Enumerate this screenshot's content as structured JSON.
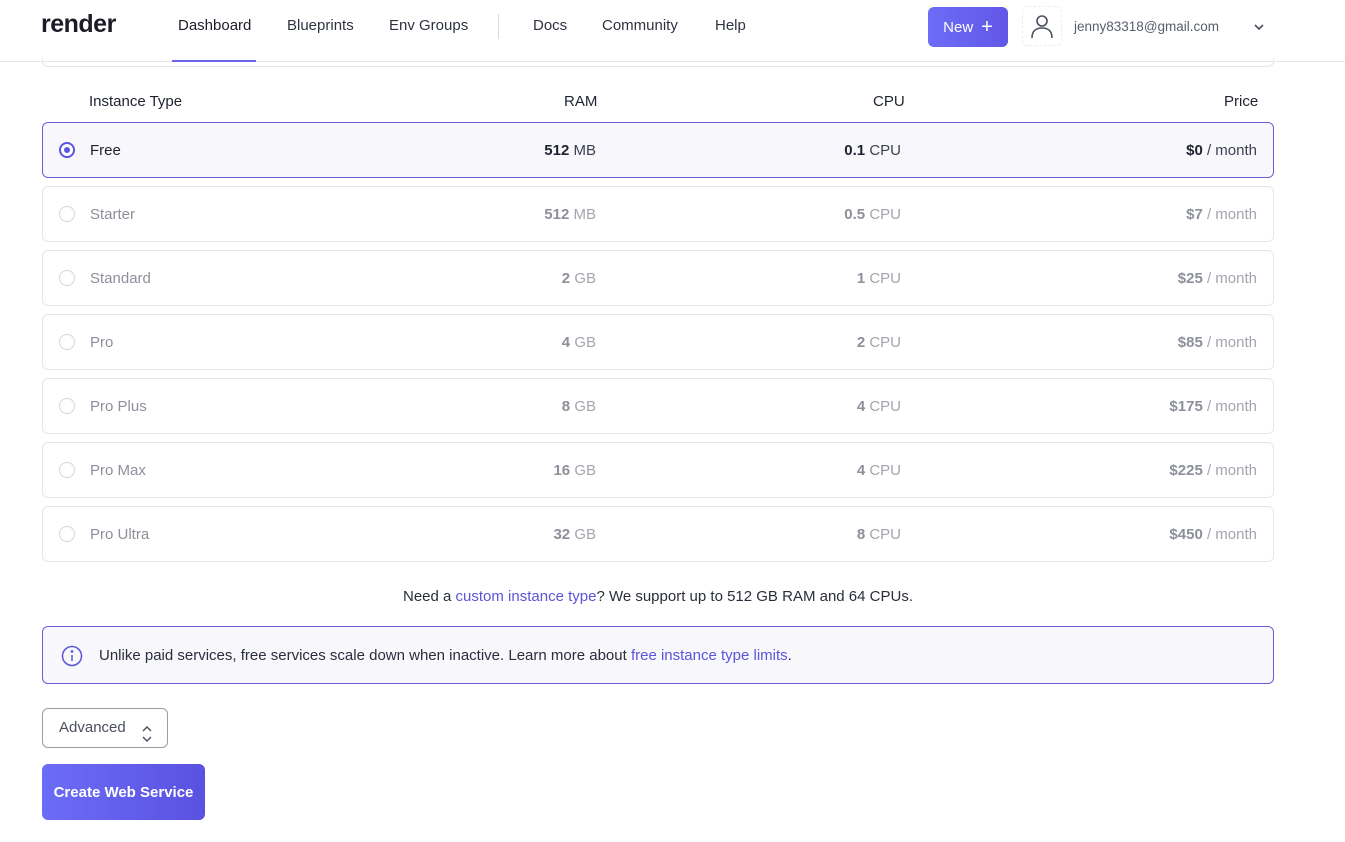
{
  "brand": {
    "logo": "render"
  },
  "nav": {
    "items": [
      {
        "label": "Dashboard"
      },
      {
        "label": "Blueprints"
      },
      {
        "label": "Env Groups"
      },
      {
        "label": "Docs"
      },
      {
        "label": "Community"
      },
      {
        "label": "Help"
      }
    ],
    "active": "Dashboard"
  },
  "header": {
    "new_label": "New",
    "new_icon": "plus-icon",
    "avatar_icon": "user-icon",
    "email": "jenny83318@gmail.com",
    "menu_icon": "chevron-down-icon"
  },
  "table": {
    "headers": {
      "type": "Instance Type",
      "ram": "RAM",
      "cpu": "CPU",
      "price": "Price"
    },
    "rows": [
      {
        "name": "Free",
        "ram_value": "512",
        "ram_unit": "MB",
        "cpu_value": "0.1",
        "cpu_unit": "CPU",
        "price_value": "$0",
        "price_unit": "/ month",
        "selected": true
      },
      {
        "name": "Starter",
        "ram_value": "512",
        "ram_unit": "MB",
        "cpu_value": "0.5",
        "cpu_unit": "CPU",
        "price_value": "$7",
        "price_unit": "/ month",
        "selected": false
      },
      {
        "name": "Standard",
        "ram_value": "2",
        "ram_unit": "GB",
        "cpu_value": "1",
        "cpu_unit": "CPU",
        "price_value": "$25",
        "price_unit": "/ month",
        "selected": false
      },
      {
        "name": "Pro",
        "ram_value": "4",
        "ram_unit": "GB",
        "cpu_value": "2",
        "cpu_unit": "CPU",
        "price_value": "$85",
        "price_unit": "/ month",
        "selected": false
      },
      {
        "name": "Pro Plus",
        "ram_value": "8",
        "ram_unit": "GB",
        "cpu_value": "4",
        "cpu_unit": "CPU",
        "price_value": "$175",
        "price_unit": "/ month",
        "selected": false
      },
      {
        "name": "Pro Max",
        "ram_value": "16",
        "ram_unit": "GB",
        "cpu_value": "4",
        "cpu_unit": "CPU",
        "price_value": "$225",
        "price_unit": "/ month",
        "selected": false
      },
      {
        "name": "Pro Ultra",
        "ram_value": "32",
        "ram_unit": "GB",
        "cpu_value": "8",
        "cpu_unit": "CPU",
        "price_value": "$450",
        "price_unit": "/ month",
        "selected": false
      }
    ]
  },
  "custom": {
    "prefix": "Need a ",
    "link": "custom instance type",
    "suffix": "? We support up to 512 GB RAM and 64 CPUs."
  },
  "info": {
    "icon": "info-icon",
    "text": "Unlike paid services, free services scale down when inactive. Learn more about ",
    "link": "free instance type limits",
    "suffix": "."
  },
  "advanced": {
    "label": "Advanced",
    "icon": "updown-chevron-icon"
  },
  "submit": {
    "label": "Create Web Service"
  },
  "colors": {
    "accent": "#6761d4",
    "button": "#6157e6"
  }
}
